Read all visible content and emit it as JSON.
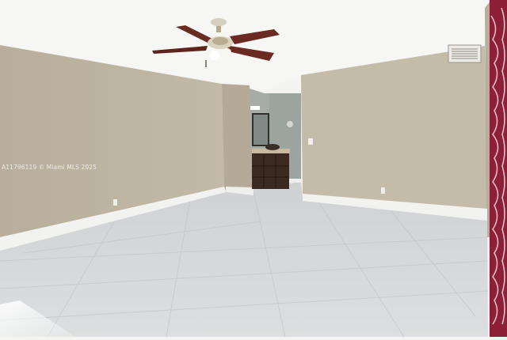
{
  "photo": {
    "subject": "empty room with tile floor, ceiling fan and bathroom vanity",
    "watermark_text": "A11796119 © Miami MLS 2025",
    "colors": {
      "ceiling": "#f6f6f4",
      "wall_left": "#bdb3a1",
      "wall_right": "#c4bca9",
      "wall_back": "#b9af9d",
      "bath_wall": "#9aa39d",
      "floor": "#d6d8da",
      "baseboard": "#f2f2f0",
      "vanity": "#3a2a22",
      "fan_blade": "#6b2b22",
      "curtain": "#8d2037"
    }
  }
}
